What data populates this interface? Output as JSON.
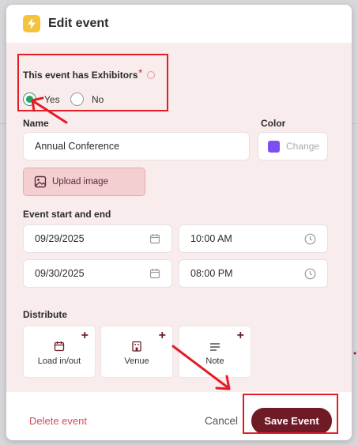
{
  "modal": {
    "title": "Edit event",
    "exhibitors": {
      "label": "This event has Exhibitors",
      "required_mark": "*",
      "options": [
        "Yes",
        "No"
      ],
      "selected": "Yes"
    },
    "name": {
      "label": "Name",
      "value": "Annual Conference"
    },
    "color": {
      "label": "Color",
      "swatch": "#7c4ff0",
      "change_label": "Change"
    },
    "upload_label": "Upload image",
    "schedule": {
      "label": "Event start and end",
      "start_date": "09/29/2025",
      "start_time": "10:00 AM",
      "end_date": "09/30/2025",
      "end_time": "08:00 PM"
    },
    "distribute": {
      "label": "Distribute",
      "items": [
        {
          "label": "Load in/out",
          "icon": "calendar-icon"
        },
        {
          "label": "Venue",
          "icon": "building-icon"
        },
        {
          "label": "Note",
          "icon": "note-lines-icon"
        }
      ]
    },
    "footer": {
      "delete_label": "Delete event",
      "cancel_label": "Cancel",
      "save_label": "Save Event"
    }
  },
  "colors": {
    "accent": "#6e1b26",
    "body_bg": "#f8ecec",
    "radio_green": "#2e9f6a",
    "annotation_red": "#e31d27"
  }
}
